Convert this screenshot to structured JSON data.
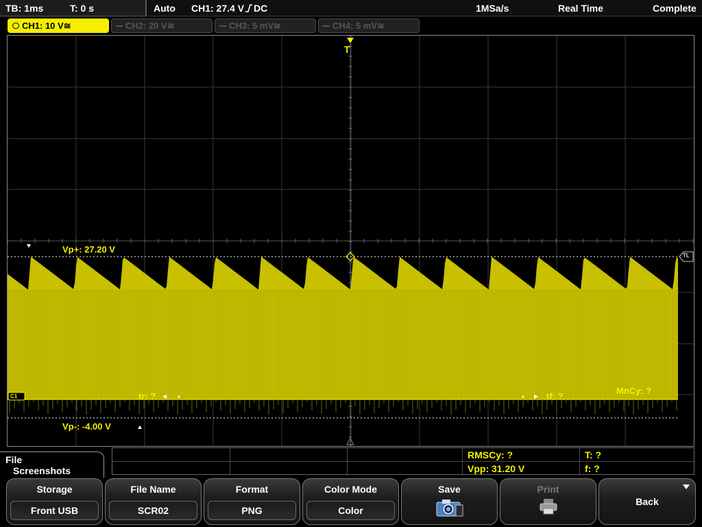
{
  "status": {
    "timebase": "TB: 1ms",
    "time_offset": "T: 0 s",
    "trigger_mode": "Auto",
    "trigger_info": "CH1: 27.4 V",
    "trigger_edge_icon": "rising-edge-icon",
    "trigger_coupling": "DC",
    "sample_rate": "1MSa/s",
    "acq_mode": "Real Time",
    "acq_state": "Complete"
  },
  "channels": [
    {
      "label": "CH1: 10 V",
      "coupling_symbol": "≅",
      "active": true
    },
    {
      "label": "CH2: 20 V",
      "coupling_symbol": "≅",
      "active": false
    },
    {
      "label": "CH3: 5 mV",
      "coupling_symbol": "≅",
      "active": false
    },
    {
      "label": "CH4: 5 mV",
      "coupling_symbol": "≅",
      "active": false
    }
  ],
  "screen": {
    "trigger_marker": "T",
    "trigger_level_marker": "TL",
    "ch1_marker": "C1",
    "cursor_labels": {
      "vp_plus": "Vp+: 27.20 V",
      "vp_minus": "Vp-: -4.00 V",
      "rise_time": "tr: ?",
      "fall_time": "tf: ?",
      "mean_cycle": "MnCy: ?"
    },
    "trace_color": "#c8c000",
    "accent_color": "#f5ee00"
  },
  "measurements": {
    "rms_cycle": "RMSCy: ?",
    "period": "T: ?",
    "vpp": "Vpp: 31.20 V",
    "frequency": "f: ?"
  },
  "menu": {
    "title_line1": "File",
    "title_line2": "Screenshots"
  },
  "softkeys": [
    {
      "label": "Storage",
      "value": "Front USB"
    },
    {
      "label": "File Name",
      "value": "SCR02"
    },
    {
      "label": "Format",
      "value": "PNG"
    },
    {
      "label": "Color Mode",
      "value": "Color"
    },
    {
      "label": "Save",
      "icon": "camera-save-icon"
    },
    {
      "label": "Print",
      "icon": "printer-icon",
      "disabled": true
    },
    {
      "label": "Back"
    }
  ]
}
